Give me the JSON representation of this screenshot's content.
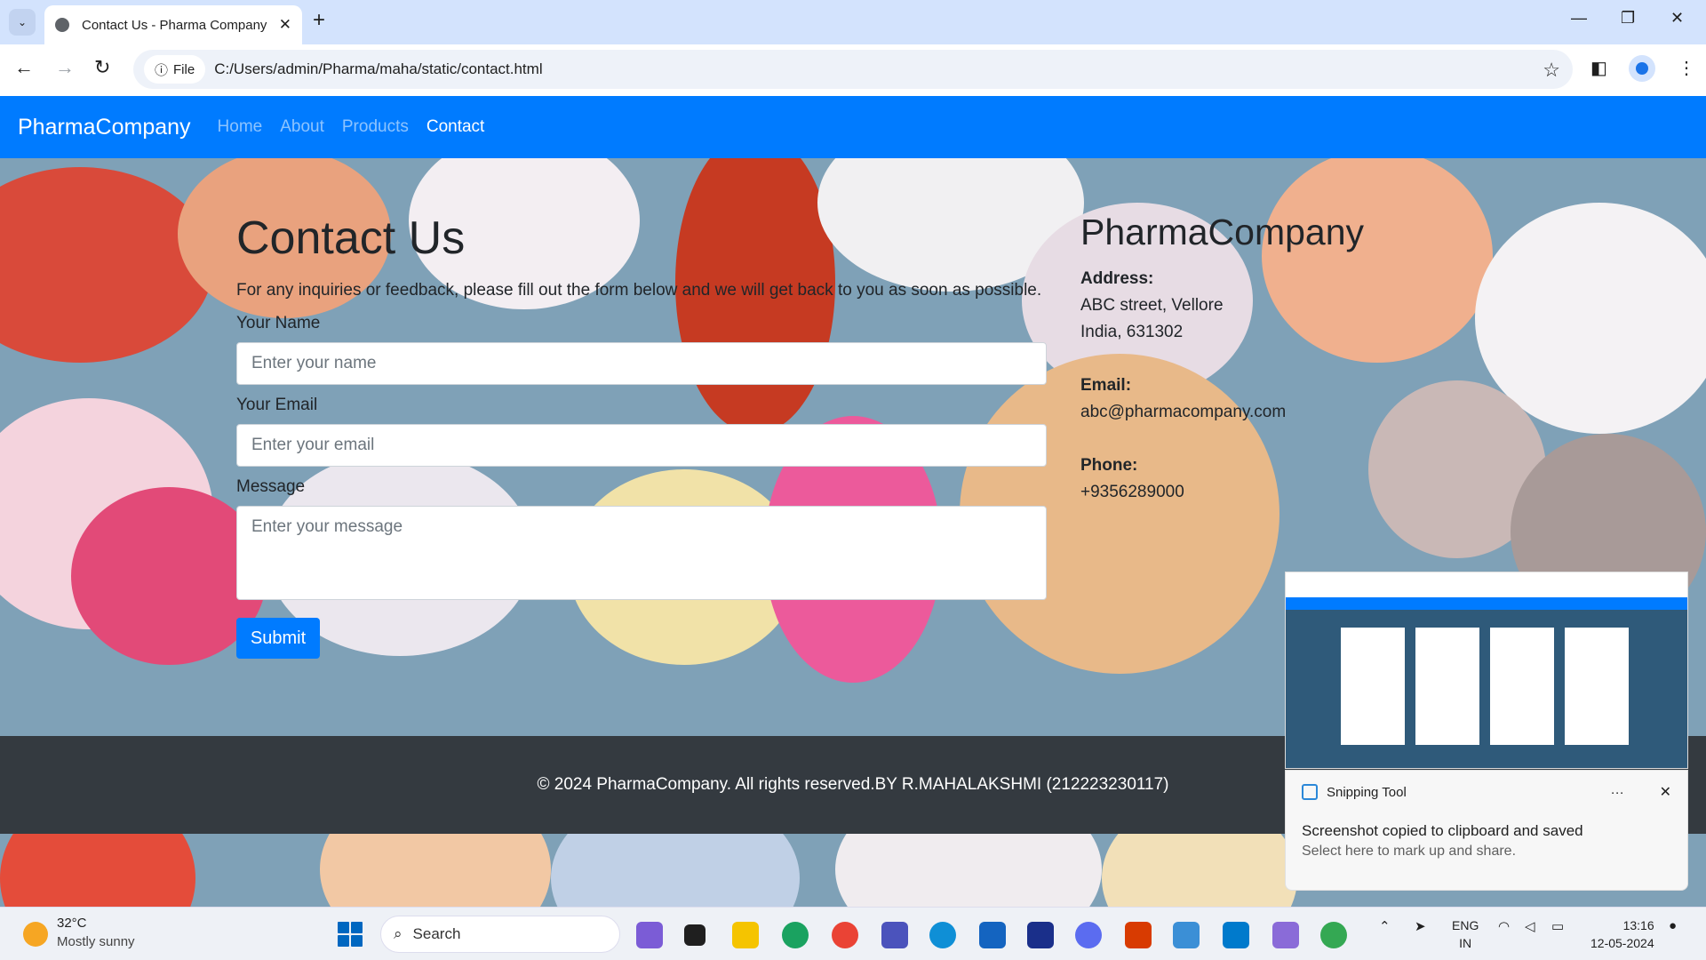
{
  "browser": {
    "tab_title": "Contact Us - Pharma Company",
    "address_chip": "File",
    "url": "C:/Users/admin/Pharma/maha/static/contact.html"
  },
  "navbar": {
    "brand": "PharmaCompany",
    "links": [
      "Home",
      "About",
      "Products",
      "Contact"
    ],
    "active": "Contact"
  },
  "contact": {
    "title": "Contact Us",
    "lead": "For any inquiries or feedback, please fill out the form below and we will get back to you as soon as possible.",
    "name_label": "Your Name",
    "name_placeholder": "Enter your name",
    "email_label": "Your Email",
    "email_placeholder": "Enter your email",
    "message_label": "Message",
    "message_placeholder": "Enter your message",
    "submit": "Submit"
  },
  "info": {
    "company": "PharmaCompany",
    "address_label": "Address:",
    "address_line1": "ABC street, Vellore",
    "address_line2": "India, 631302",
    "email_label": "Email:",
    "email": "abc@pharmacompany.com",
    "phone_label": "Phone:",
    "phone": "+9356289000"
  },
  "footer": {
    "text": "© 2024 PharmaCompany. All rights reserved.BY R.MAHALAKSHMI (212223230117)"
  },
  "snipping_tool": {
    "app": "Snipping Tool",
    "more": "···",
    "message": "Screenshot copied to clipboard and saved",
    "sub": "Select here to mark up and share."
  },
  "taskbar": {
    "temperature": "32°C",
    "weather": "Mostly sunny",
    "search": "Search",
    "lang1": "ENG",
    "lang2": "IN",
    "time": "13:16",
    "date": "12-05-2024"
  },
  "colors": {
    "navbar": "#007bff",
    "footer": "#343a40",
    "tab_strip": "#d3e3fd"
  }
}
